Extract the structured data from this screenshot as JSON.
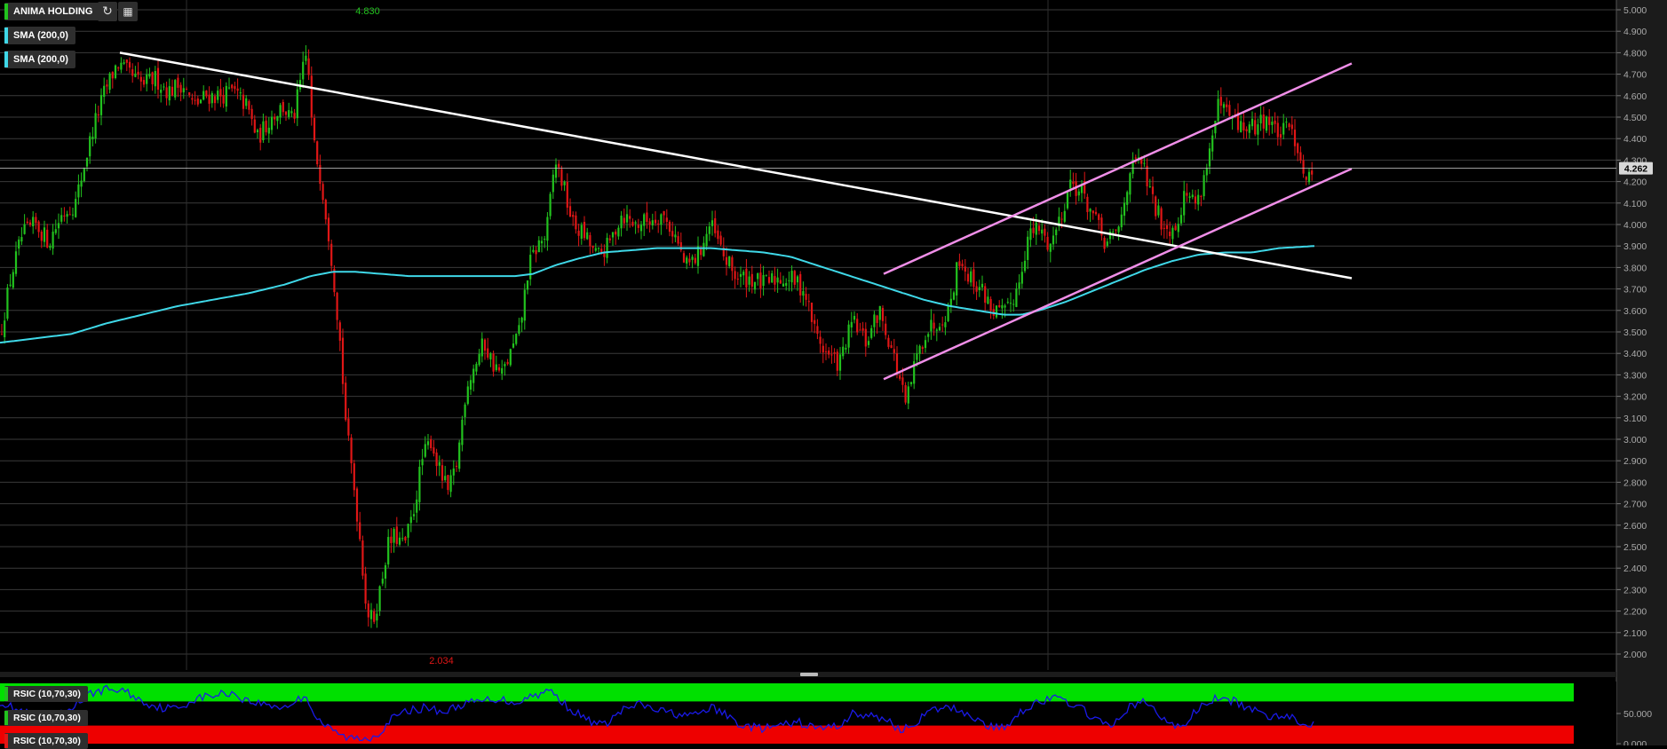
{
  "header": {
    "symbol": "ANIMA HOLDING",
    "indicators": [
      "SMA (200,0)",
      "SMA (200,0)"
    ],
    "refresh_icon": "refresh-icon",
    "calendar_icon": "calendar-icon"
  },
  "colors": {
    "up": "#22c21e",
    "down": "#e01616",
    "sma": "#3fd8e8",
    "trendline": "#ffffff",
    "channel": "#f08ee8",
    "rsi_line": "#1a1ae8",
    "rsi_overbought": "#00e000",
    "rsi_oversold": "#ee0000"
  },
  "chart_data": [
    {
      "type": "candlestick",
      "title": "ANIMA HOLDING",
      "ylim": [
        1.95,
        5.0
      ],
      "y_ticks": [
        "5.000",
        "4.900",
        "4.800",
        "4.700",
        "4.600",
        "4.500",
        "4.400",
        "4.300",
        "4.200",
        "4.100",
        "4.000",
        "3.900",
        "3.800",
        "3.700",
        "3.600",
        "3.500",
        "3.400",
        "3.300",
        "3.200",
        "3.100",
        "3.000",
        "2.900",
        "2.800",
        "2.700",
        "2.600",
        "2.500",
        "2.400",
        "2.300",
        "2.200",
        "2.100",
        "2.000"
      ],
      "last_price": "4.262",
      "annotations": {
        "high": "4.830",
        "low": "2.034"
      },
      "price_path": [
        [
          0,
          3.48
        ],
        [
          12,
          3.75
        ],
        [
          25,
          3.95
        ],
        [
          40,
          4.0
        ],
        [
          55,
          3.92
        ],
        [
          70,
          4.05
        ],
        [
          85,
          4.1
        ],
        [
          95,
          4.28
        ],
        [
          105,
          4.45
        ],
        [
          118,
          4.62
        ],
        [
          132,
          4.75
        ],
        [
          145,
          4.7
        ],
        [
          160,
          4.65
        ],
        [
          175,
          4.68
        ],
        [
          190,
          4.62
        ],
        [
          205,
          4.66
        ],
        [
          218,
          4.55
        ],
        [
          232,
          4.6
        ],
        [
          248,
          4.6
        ],
        [
          262,
          4.62
        ],
        [
          278,
          4.55
        ],
        [
          290,
          4.4
        ],
        [
          305,
          4.5
        ],
        [
          318,
          4.55
        ],
        [
          330,
          4.48
        ],
        [
          340,
          4.7
        ],
        [
          346,
          4.8
        ],
        [
          352,
          4.4
        ],
        [
          362,
          4.2
        ],
        [
          372,
          3.9
        ],
        [
          382,
          3.5
        ],
        [
          390,
          3.05
        ],
        [
          398,
          2.8
        ],
        [
          405,
          2.55
        ],
        [
          413,
          2.2
        ],
        [
          420,
          2.15
        ],
        [
          428,
          2.3
        ],
        [
          436,
          2.5
        ],
        [
          445,
          2.55
        ],
        [
          455,
          2.5
        ],
        [
          465,
          2.65
        ],
        [
          475,
          2.9
        ],
        [
          485,
          3.0
        ],
        [
          495,
          2.85
        ],
        [
          505,
          2.75
        ],
        [
          515,
          2.9
        ],
        [
          525,
          3.25
        ],
        [
          535,
          3.35
        ],
        [
          545,
          3.45
        ],
        [
          555,
          3.35
        ],
        [
          565,
          3.3
        ],
        [
          575,
          3.4
        ],
        [
          585,
          3.5
        ],
        [
          595,
          3.8
        ],
        [
          605,
          3.9
        ],
        [
          615,
          3.95
        ],
        [
          625,
          4.3
        ],
        [
          633,
          4.2
        ],
        [
          645,
          4.0
        ],
        [
          658,
          3.95
        ],
        [
          672,
          3.85
        ],
        [
          685,
          3.9
        ],
        [
          700,
          4.05
        ],
        [
          715,
          4.0
        ],
        [
          730,
          4.02
        ],
        [
          745,
          4.05
        ],
        [
          760,
          3.95
        ],
        [
          772,
          3.8
        ],
        [
          785,
          3.85
        ],
        [
          800,
          4.0
        ],
        [
          815,
          3.85
        ],
        [
          830,
          3.75
        ],
        [
          845,
          3.75
        ],
        [
          860,
          3.72
        ],
        [
          875,
          3.75
        ],
        [
          890,
          3.75
        ],
        [
          905,
          3.7
        ],
        [
          918,
          3.5
        ],
        [
          930,
          3.4
        ],
        [
          945,
          3.35
        ],
        [
          960,
          3.55
        ],
        [
          975,
          3.45
        ],
        [
          990,
          3.6
        ],
        [
          1002,
          3.45
        ],
        [
          1012,
          3.3
        ],
        [
          1020,
          3.15
        ],
        [
          1030,
          3.35
        ],
        [
          1042,
          3.5
        ],
        [
          1055,
          3.55
        ],
        [
          1068,
          3.6
        ],
        [
          1080,
          3.85
        ],
        [
          1092,
          3.75
        ],
        [
          1105,
          3.7
        ],
        [
          1118,
          3.6
        ],
        [
          1132,
          3.58
        ],
        [
          1145,
          3.7
        ],
        [
          1158,
          3.95
        ],
        [
          1170,
          3.98
        ],
        [
          1182,
          3.9
        ],
        [
          1195,
          4.05
        ],
        [
          1205,
          4.2
        ],
        [
          1218,
          4.15
        ],
        [
          1230,
          4.05
        ],
        [
          1245,
          3.9
        ],
        [
          1260,
          3.98
        ],
        [
          1272,
          4.25
        ],
        [
          1285,
          4.3
        ],
        [
          1298,
          4.1
        ],
        [
          1310,
          4.0
        ],
        [
          1322,
          3.98
        ],
        [
          1335,
          4.15
        ],
        [
          1348,
          4.1
        ],
        [
          1360,
          4.3
        ],
        [
          1372,
          4.55
        ],
        [
          1385,
          4.5
        ],
        [
          1398,
          4.45
        ],
        [
          1412,
          4.45
        ],
        [
          1425,
          4.5
        ],
        [
          1440,
          4.42
        ],
        [
          1455,
          4.45
        ],
        [
          1465,
          4.3
        ],
        [
          1472,
          4.2
        ],
        [
          1480,
          4.26
        ]
      ],
      "sma_200": [
        [
          0,
          3.45
        ],
        [
          40,
          3.47
        ],
        [
          80,
          3.49
        ],
        [
          120,
          3.54
        ],
        [
          160,
          3.58
        ],
        [
          200,
          3.62
        ],
        [
          240,
          3.65
        ],
        [
          280,
          3.68
        ],
        [
          320,
          3.72
        ],
        [
          350,
          3.76
        ],
        [
          375,
          3.78
        ],
        [
          400,
          3.78
        ],
        [
          430,
          3.77
        ],
        [
          460,
          3.76
        ],
        [
          490,
          3.76
        ],
        [
          520,
          3.76
        ],
        [
          550,
          3.76
        ],
        [
          580,
          3.76
        ],
        [
          600,
          3.77
        ],
        [
          625,
          3.81
        ],
        [
          650,
          3.84
        ],
        [
          680,
          3.87
        ],
        [
          710,
          3.88
        ],
        [
          740,
          3.89
        ],
        [
          770,
          3.89
        ],
        [
          800,
          3.89
        ],
        [
          830,
          3.88
        ],
        [
          860,
          3.87
        ],
        [
          890,
          3.85
        ],
        [
          920,
          3.81
        ],
        [
          950,
          3.77
        ],
        [
          980,
          3.73
        ],
        [
          1010,
          3.69
        ],
        [
          1040,
          3.65
        ],
        [
          1070,
          3.62
        ],
        [
          1100,
          3.6
        ],
        [
          1130,
          3.58
        ],
        [
          1150,
          3.58
        ],
        [
          1170,
          3.6
        ],
        [
          1200,
          3.64
        ],
        [
          1230,
          3.69
        ],
        [
          1260,
          3.74
        ],
        [
          1290,
          3.79
        ],
        [
          1320,
          3.83
        ],
        [
          1350,
          3.86
        ],
        [
          1380,
          3.87
        ],
        [
          1410,
          3.87
        ],
        [
          1440,
          3.89
        ],
        [
          1480,
          3.9
        ]
      ],
      "trendline": [
        [
          135,
          4.8
        ],
        [
          1522,
          3.75
        ]
      ],
      "channel_upper": [
        [
          995,
          3.77
        ],
        [
          1522,
          4.75
        ]
      ],
      "channel_lower": [
        [
          995,
          3.28
        ],
        [
          1522,
          4.26
        ]
      ],
      "x_gridlines": [
        210,
        1180
      ],
      "last_price_line": 4.262
    },
    {
      "type": "line",
      "title": "RSIC (10,70,30)",
      "ylim": [
        0,
        100
      ],
      "y_ticks": [
        "50.000",
        "0.000"
      ],
      "series": [
        {
          "name": "RSIC (10,70,30)",
          "path": [
            [
              0,
              70
            ],
            [
              20,
              55
            ],
            [
              40,
              45
            ],
            [
              60,
              40
            ],
            [
              80,
              60
            ],
            [
              95,
              75
            ],
            [
              105,
              85
            ],
            [
              120,
              90
            ],
            [
              140,
              88
            ],
            [
              160,
              70
            ],
            [
              180,
              60
            ],
            [
              200,
              58
            ],
            [
              220,
              75
            ],
            [
              240,
              80
            ],
            [
              260,
              85
            ],
            [
              280,
              70
            ],
            [
              300,
              65
            ],
            [
              320,
              60
            ],
            [
              345,
              80
            ],
            [
              355,
              45
            ],
            [
              370,
              25
            ],
            [
              390,
              10
            ],
            [
              410,
              8
            ],
            [
              425,
              15
            ],
            [
              440,
              40
            ],
            [
              460,
              55
            ],
            [
              480,
              60
            ],
            [
              500,
              52
            ],
            [
              520,
              65
            ],
            [
              540,
              70
            ],
            [
              560,
              75
            ],
            [
              580,
              68
            ],
            [
              600,
              80
            ],
            [
              620,
              88
            ],
            [
              640,
              60
            ],
            [
              660,
              40
            ],
            [
              680,
              30
            ],
            [
              700,
              55
            ],
            [
              720,
              65
            ],
            [
              740,
              55
            ],
            [
              760,
              50
            ],
            [
              780,
              45
            ],
            [
              800,
              60
            ],
            [
              815,
              50
            ],
            [
              835,
              30
            ],
            [
              860,
              25
            ],
            [
              880,
              30
            ],
            [
              900,
              35
            ],
            [
              920,
              25
            ],
            [
              945,
              30
            ],
            [
              960,
              50
            ],
            [
              980,
              45
            ],
            [
              1000,
              40
            ],
            [
              1015,
              20
            ],
            [
              1030,
              35
            ],
            [
              1050,
              55
            ],
            [
              1070,
              60
            ],
            [
              1090,
              50
            ],
            [
              1110,
              30
            ],
            [
              1130,
              25
            ],
            [
              1150,
              55
            ],
            [
              1170,
              70
            ],
            [
              1190,
              75
            ],
            [
              1210,
              65
            ],
            [
              1230,
              45
            ],
            [
              1250,
              25
            ],
            [
              1270,
              60
            ],
            [
              1290,
              70
            ],
            [
              1310,
              40
            ],
            [
              1330,
              25
            ],
            [
              1350,
              60
            ],
            [
              1370,
              75
            ],
            [
              1390,
              70
            ],
            [
              1410,
              55
            ],
            [
              1430,
              45
            ],
            [
              1450,
              50
            ],
            [
              1465,
              30
            ],
            [
              1480,
              35
            ]
          ]
        }
      ],
      "overbought": 70,
      "oversold": 30
    }
  ],
  "rsi_tags": [
    "RSIC (10,70,30)",
    "RSIC (10,70,30)",
    "RSIC (10,70,30)"
  ]
}
